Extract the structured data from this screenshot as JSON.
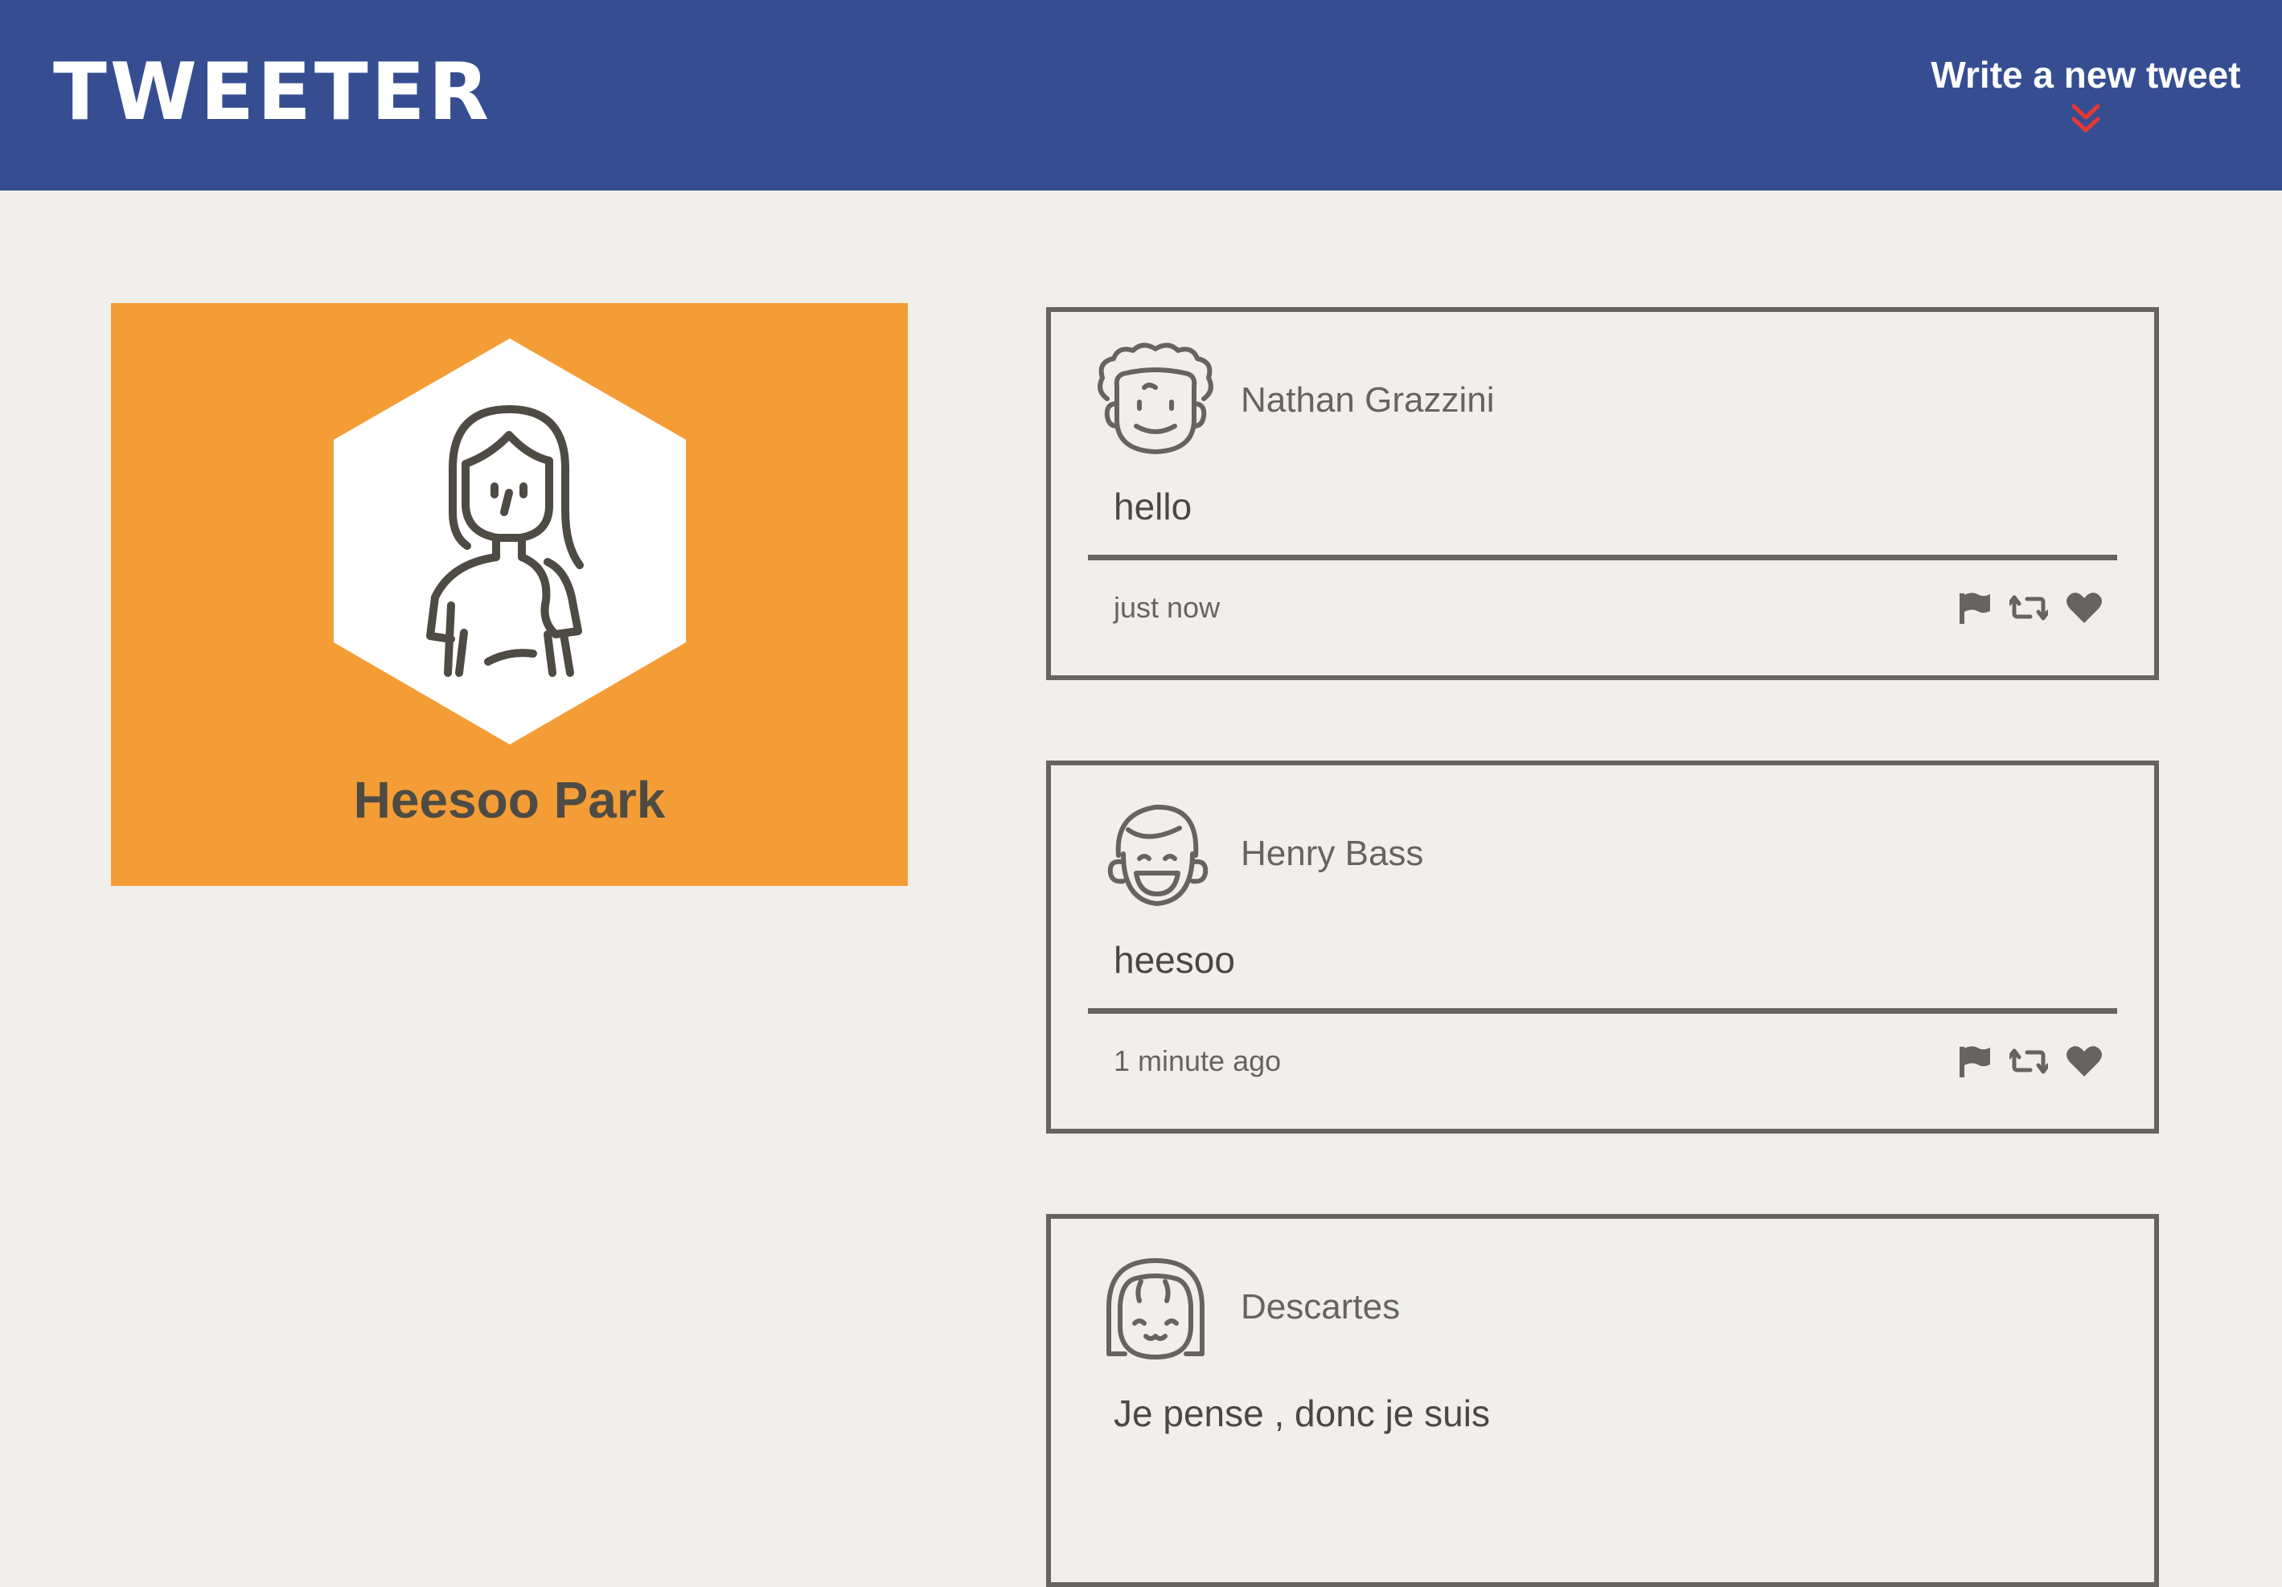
{
  "header": {
    "brand": "TWEETER",
    "compose_label": "Write a new tweet",
    "compose_icon": "double-chevron-down-icon",
    "colors": {
      "background": "#364e91",
      "text": "#ffffff",
      "compose_icon": "#e53935"
    }
  },
  "profile": {
    "name": "Heesoo Park",
    "avatar_icon": "woman-avatar-icon",
    "colors": {
      "card": "#f49d36",
      "name": "#4e4b44"
    }
  },
  "tweets": [
    {
      "author": "Nathan Grazzini",
      "avatar_icon": "curly-hair-avatar-icon",
      "body": "hello",
      "time": "just now"
    },
    {
      "author": "Henry Bass",
      "avatar_icon": "laughing-avatar-icon",
      "body": "heesoo",
      "time": "1 minute ago"
    },
    {
      "author": "Descartes",
      "avatar_icon": "bangs-avatar-icon",
      "body": "Je pense , donc je suis",
      "time": ""
    }
  ],
  "tweet_actions": [
    "flag-icon",
    "retweet-icon",
    "heart-icon"
  ],
  "colors": {
    "page_background": "#f1efeb",
    "tweet_border": "#666461"
  }
}
